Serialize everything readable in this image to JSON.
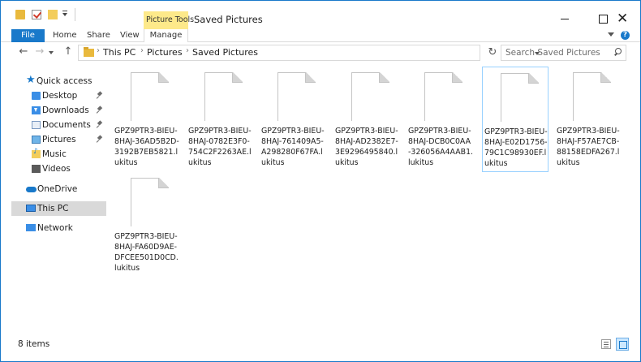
{
  "window": {
    "title": "Saved Pictures",
    "contextual_tab_group": "Picture Tools"
  },
  "ribbon": {
    "tabs": [
      "File",
      "Home",
      "Share",
      "View",
      "Manage"
    ],
    "help": "?"
  },
  "address_bar": {
    "crumbs": [
      "This PC",
      "Pictures",
      "Saved Pictures"
    ],
    "search_placeholder": "Search Saved Pictures"
  },
  "nav_pane": {
    "quick_access": "Quick access",
    "pinned": [
      "Desktop",
      "Downloads",
      "Documents",
      "Pictures"
    ],
    "unpinned": [
      "Music",
      "Videos"
    ],
    "onedrive": "OneDrive",
    "this_pc": "This PC",
    "network": "Network"
  },
  "files": [
    {
      "name": "GPZ9PTR3-BIEU-8HAJ-36AD5B2D-3192B7EB5821.lukitus",
      "selected": false
    },
    {
      "name": "GPZ9PTR3-BIEU-8HAJ-0782E3F0-754C2F2263AE.lukitus",
      "selected": false
    },
    {
      "name": "GPZ9PTR3-BIEU-8HAJ-761409A5-A298280F67FA.lukitus",
      "selected": false
    },
    {
      "name": "GPZ9PTR3-BIEU-8HAJ-AD2382E7-3E9296495840.lukitus",
      "selected": false
    },
    {
      "name": "GPZ9PTR3-BIEU-8HAJ-DCB0C0AA-326056A4AAB1.lukitus",
      "selected": false
    },
    {
      "name": "GPZ9PTR3-BIEU-8HAJ-E02D1756-79C1C98930EF.lukitus",
      "selected": true
    },
    {
      "name": "GPZ9PTR3-BIEU-8HAJ-F57AE7CB-88158EDFA267.lukitus",
      "selected": false
    },
    {
      "name": "GPZ9PTR3-BIEU-8HAJ-FA60D9AE-DFCEE501D0CD.lukitus",
      "selected": false
    }
  ],
  "status": {
    "item_count": "8 items"
  },
  "colors": {
    "accent": "#1979ca",
    "contextual_tab": "#fde98a",
    "selection": "#cce8ff"
  }
}
